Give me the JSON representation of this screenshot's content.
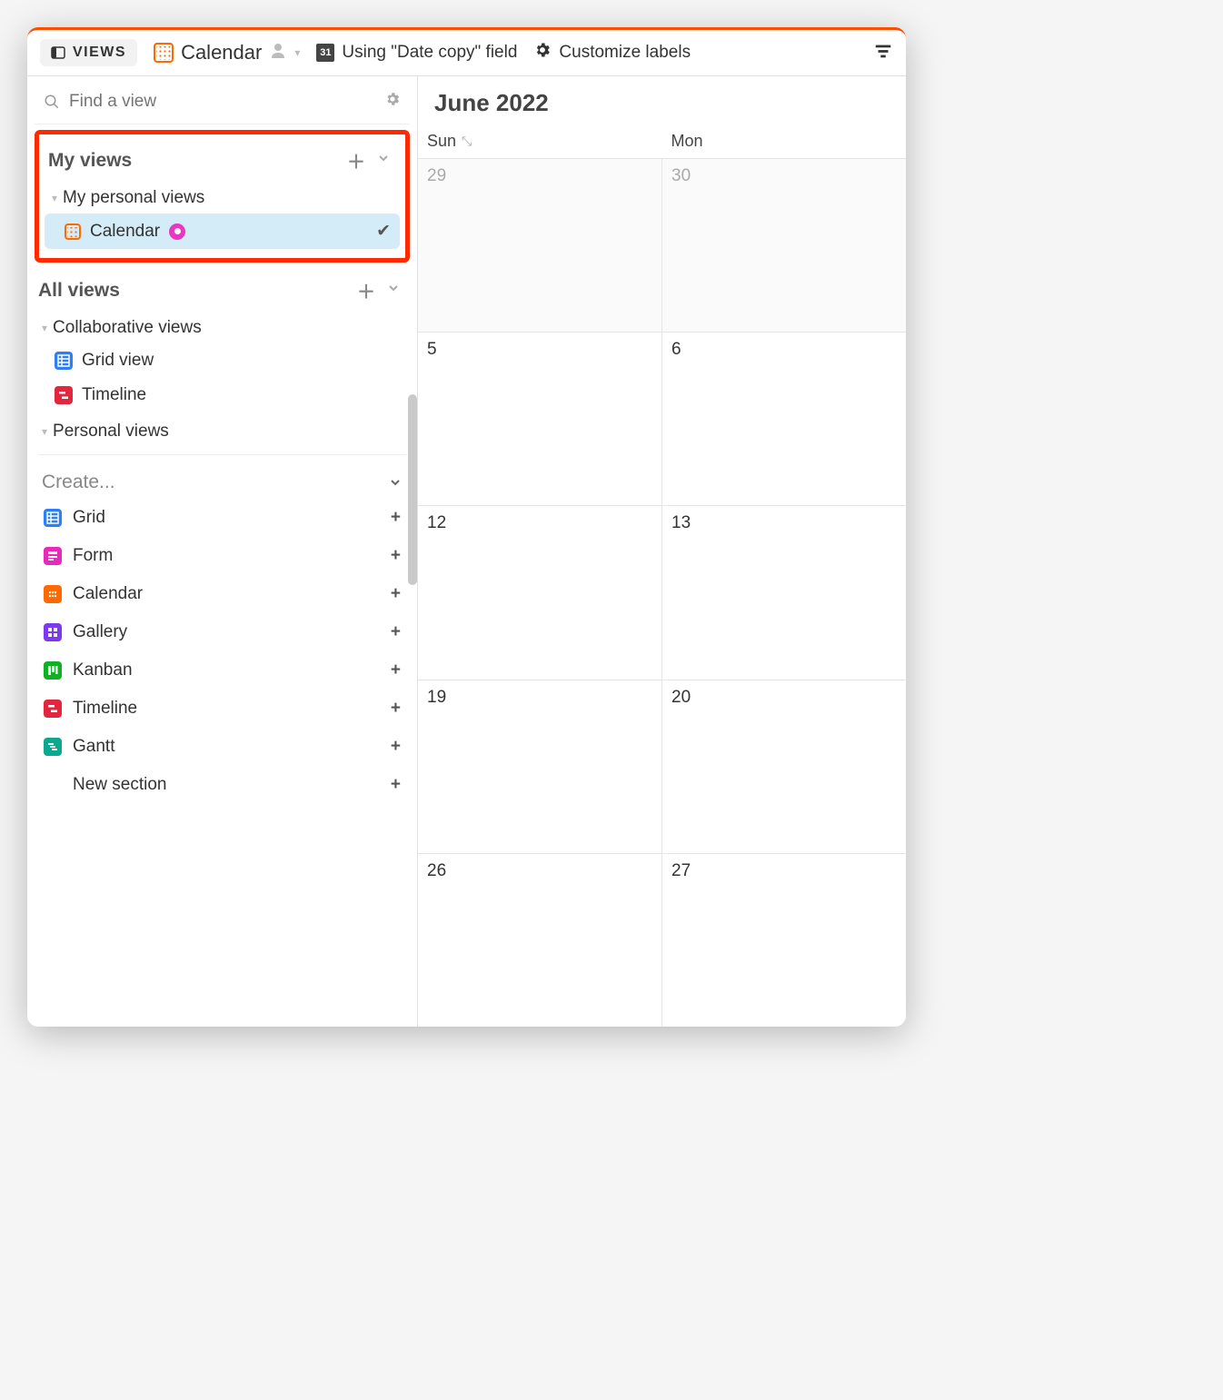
{
  "toolbar": {
    "views_label": "VIEWS",
    "current_view": "Calendar",
    "date_field_label": "Using \"Date copy\" field",
    "date_icon_text": "31",
    "customize_label": "Customize labels"
  },
  "sidebar": {
    "search_placeholder": "Find a view",
    "my_views": {
      "title": "My views",
      "groups": [
        {
          "title": "My personal views",
          "items": [
            {
              "label": "Calendar",
              "selected": true
            }
          ]
        }
      ]
    },
    "all_views": {
      "title": "All views",
      "groups": [
        {
          "title": "Collaborative views",
          "items": [
            {
              "label": "Grid view",
              "icon": "grid"
            },
            {
              "label": "Timeline",
              "icon": "timeline"
            }
          ]
        },
        {
          "title": "Personal views",
          "items": []
        }
      ]
    },
    "create": {
      "title": "Create...",
      "options": [
        {
          "label": "Grid",
          "icon": "grid"
        },
        {
          "label": "Form",
          "icon": "form"
        },
        {
          "label": "Calendar",
          "icon": "cal"
        },
        {
          "label": "Gallery",
          "icon": "gallery"
        },
        {
          "label": "Kanban",
          "icon": "kanban"
        },
        {
          "label": "Timeline",
          "icon": "timeline"
        },
        {
          "label": "Gantt",
          "icon": "gantt"
        },
        {
          "label": "New section",
          "icon": ""
        }
      ]
    }
  },
  "calendar": {
    "title": "June 2022",
    "day_headers": [
      "Sun",
      "Mon"
    ],
    "weeks": [
      [
        {
          "n": "29",
          "faded": true
        },
        {
          "n": "30",
          "faded": true
        }
      ],
      [
        {
          "n": "5"
        },
        {
          "n": "6"
        }
      ],
      [
        {
          "n": "12"
        },
        {
          "n": "13"
        }
      ],
      [
        {
          "n": "19"
        },
        {
          "n": "20"
        }
      ],
      [
        {
          "n": "26"
        },
        {
          "n": "27"
        }
      ]
    ]
  }
}
